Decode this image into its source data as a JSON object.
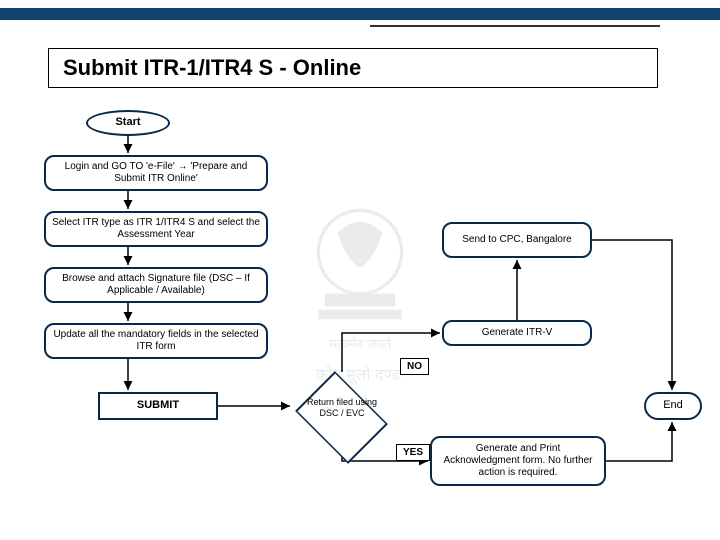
{
  "title": "Submit ITR-1/ITR4 S - Online",
  "nodes": {
    "start": "Start",
    "step1": "Login and GO TO 'e-File' → 'Prepare and Submit ITR Online'",
    "step2": "Select ITR type as ITR 1/ITR4 S and select the Assessment Year",
    "step3": "Browse and attach Signature file (DSC – If Applicable / Available)",
    "step4": "Update all the mandatory fields in the selected ITR form",
    "submit": "SUBMIT",
    "decision": "Return filed using DSC / EVC",
    "no": "NO",
    "yes": "YES",
    "genv": "Generate ITR-V",
    "cpc": "Send to CPC, Bangalore",
    "ack": "Generate and Print Acknowledgment form. No further action is required.",
    "end": "End"
  }
}
